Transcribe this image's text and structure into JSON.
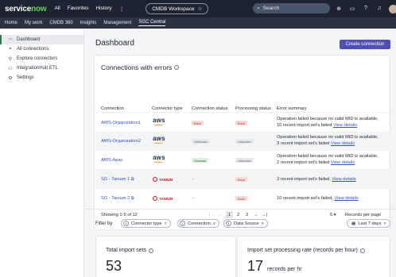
{
  "topbar": {
    "logo_main": "service",
    "logo_now": "now",
    "nav": [
      "All",
      "Favorites",
      "History",
      "⋮"
    ],
    "workspace": "CMDB Workspace",
    "search_placeholder": "Search"
  },
  "subnav": [
    "Home",
    "My work",
    "CMDB 360",
    "Insights",
    "Management",
    "SGC Central"
  ],
  "sidebar": {
    "items": [
      {
        "label": "Dashboard",
        "icon": "dashboard-icon",
        "active": true
      },
      {
        "label": "All connections",
        "icon": "connections-icon"
      },
      {
        "label": "Explore connectors",
        "icon": "explore-icon"
      },
      {
        "label": "IntegrationHub ETL",
        "icon": "etl-icon"
      },
      {
        "label": "Settings",
        "icon": "settings-icon"
      }
    ]
  },
  "main": {
    "title": "Dashboard",
    "create_button": "Create connection"
  },
  "errors_card": {
    "title": "Connections with errors",
    "columns": [
      "Connection",
      "Connector type",
      "Connection status",
      "Processing status",
      "Error summary"
    ],
    "rows": [
      {
        "connection": "AWS-Organization1",
        "type": "aws",
        "conn_status": "Error",
        "proc_status": "Error",
        "summary_1": "Operation failed because no valid MID is available,",
        "summary_2": "10 recent import set's failed ",
        "link": "View details"
      },
      {
        "connection": "AWS-Organization2",
        "type": "aws",
        "conn_status": "Unknown",
        "proc_status": "Unknown",
        "summary_1": "Operation failed because no valid MID is available,",
        "summary_2": "3 recent import set's failed ",
        "link": "View details"
      },
      {
        "connection": "AWS-Apac",
        "type": "aws",
        "conn_status": "Success",
        "proc_status": "Unknown",
        "summary_1": "Operation failed because no valid MID is available,",
        "summary_2": "2 recent import set's failed ",
        "link": "View details"
      },
      {
        "connection": "SG - Tanium 1",
        "type": "TANIUM",
        "conn_status": "-",
        "proc_status": "Error",
        "summary_1": "",
        "summary_2": "3 recent import set's failed. ",
        "link": "View details"
      },
      {
        "connection": "SG - Tanium 2",
        "type": "TANIUM",
        "conn_status": "-",
        "proc_status": "Error",
        "summary_1": "",
        "summary_2": "10 recent import set's failed. ",
        "link": "View details"
      }
    ],
    "showing": "Showing 1-5 of 12",
    "pages": [
      "1",
      "2",
      "3"
    ],
    "page_size": "5",
    "records_label": "Records per page"
  },
  "filters": {
    "label": "Filter by",
    "chips": [
      {
        "count": "1",
        "label": "Connector type"
      },
      {
        "count": "1",
        "label": "Connection"
      },
      {
        "count": "1",
        "label": "Data Source"
      }
    ],
    "time_range": "Last 7 days"
  },
  "kpis": [
    {
      "title": "Total import sets",
      "value": "53",
      "unit": ""
    },
    {
      "title": "Import set processing rate (records per hour)",
      "value": "17",
      "unit": "records per hr"
    }
  ],
  "colors": {
    "topbar": "#1d2330",
    "accent": "#4f50b3",
    "brand_green": "#62d84e",
    "error_bg": "#f9d6d6",
    "success_bg": "#d9f0d9",
    "link": "#2e55b8"
  }
}
